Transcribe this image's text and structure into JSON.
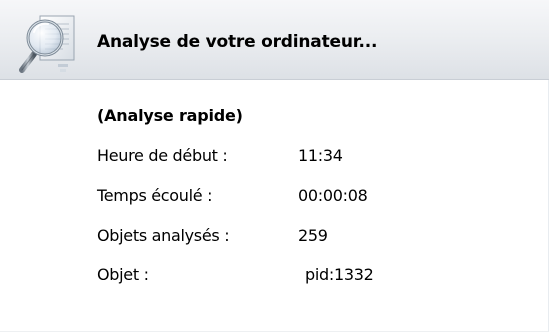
{
  "header": {
    "title": "Analyse de votre ordinateur...",
    "icon": "magnifier-document-icon"
  },
  "scan": {
    "mode": "(Analyse rapide)",
    "rows": [
      {
        "label": "Heure de début :",
        "value": "11:34"
      },
      {
        "label": "Temps écoulé :",
        "value": "00:00:08"
      },
      {
        "label": "Objets analysés :",
        "value": "259"
      },
      {
        "label": "Objet :",
        "value": "pid:1332"
      }
    ]
  }
}
